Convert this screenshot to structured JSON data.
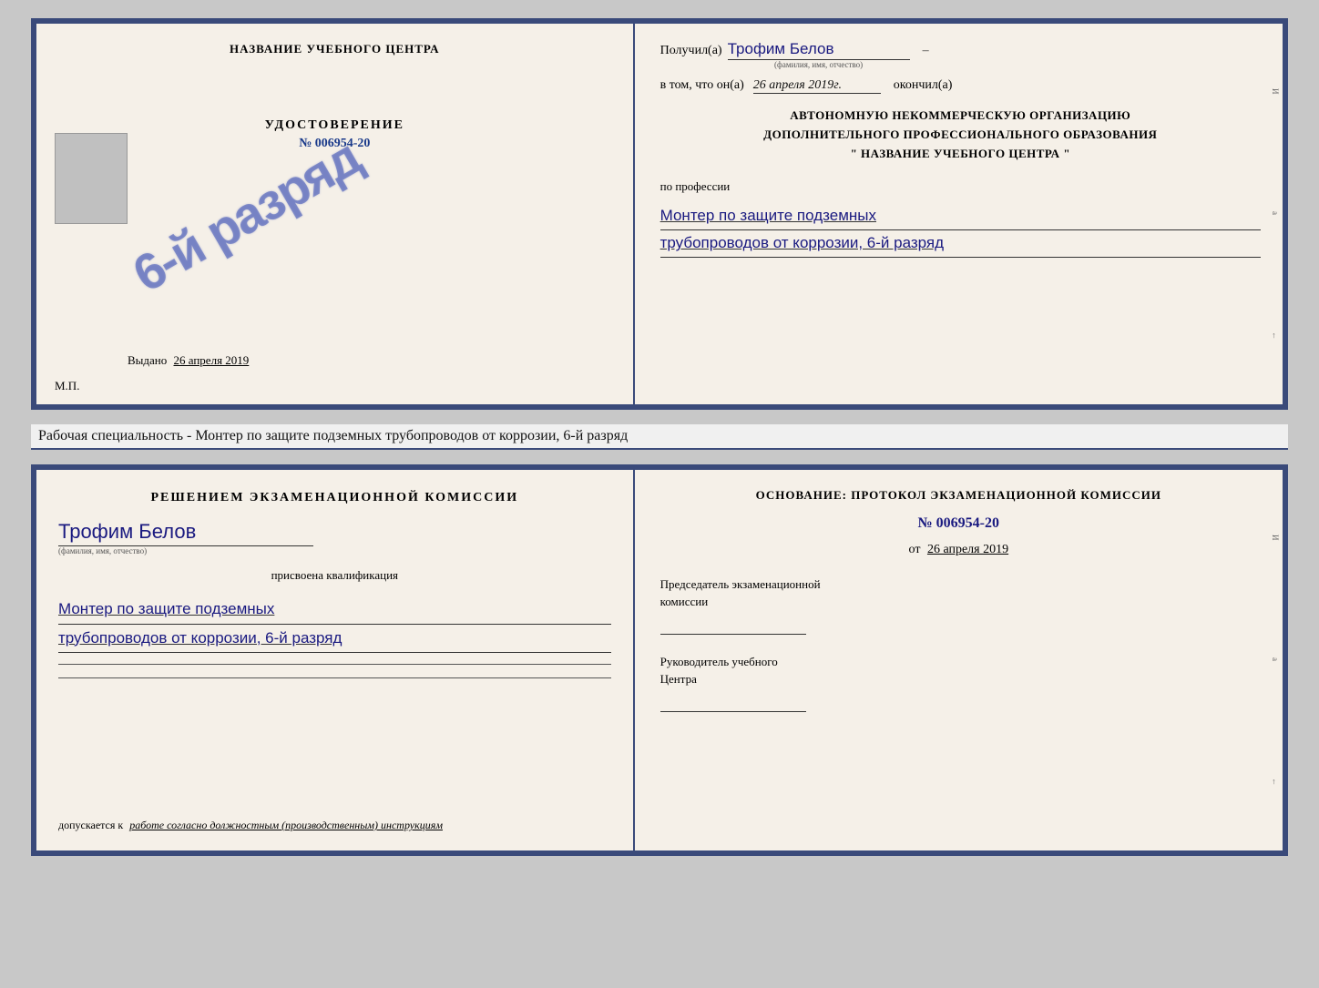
{
  "cert_top": {
    "left": {
      "center_title": "НАЗВАНИЕ УЧЕБНОГО ЦЕНТРА",
      "udost_label": "УДОСТОВЕРЕНИЕ",
      "udost_number": "№ 006954-20",
      "stamp_text": "6-й разряд",
      "vydano_label": "Выдано",
      "vydano_date": "26 апреля 2019",
      "mp_label": "М.П."
    },
    "right": {
      "poluchil_label": "Получил(а)",
      "poluchil_name": "Трофим Белов",
      "fio_hint": "(фамилия, имя, отчество)",
      "dash": "–",
      "vtom_label": "в том, что он(а)",
      "vtom_date": "26 апреля 2019г.",
      "okonchil_label": "окончил(а)",
      "org_line1": "АВТОНОМНУЮ НЕКОММЕРЧЕСКУЮ ОРГАНИЗАЦИЮ",
      "org_line2": "ДОПОЛНИТЕЛЬНОГО ПРОФЕССИОНАЛЬНОГО ОБРАЗОВАНИЯ",
      "org_line3": "\" НАЗВАНИЕ УЧЕБНОГО ЦЕНТРА \"",
      "po_professii": "по профессии",
      "profession_line1": "Монтер по защите подземных",
      "profession_line2": "трубопроводов от коррозии, 6-й разряд"
    }
  },
  "description": "Рабочая специальность - Монтер по защите подземных трубопроводов от коррозии, 6-й разряд",
  "cert_bottom": {
    "left": {
      "resheniyem_label": "Решением экзаменационной комиссии",
      "name": "Трофим Белов",
      "fio_hint": "(фамилия, имя, отчество)",
      "prisvoena": "присвоена квалификация",
      "qual_line1": "Монтер по защите подземных",
      "qual_line2": "трубопроводов от коррозии, 6-й разряд",
      "dopusk_prefix": "допускается к",
      "dopusk_text": "работе согласно должностным (производственным) инструкциям"
    },
    "right": {
      "osnovanie_label": "Основание: протокол экзаменационной комиссии",
      "protocol_number": "№ 006954-20",
      "ot_prefix": "от",
      "ot_date": "26 апреля 2019",
      "predsedatel_line1": "Председатель экзаменационной",
      "predsedatel_line2": "комиссии",
      "rukovoditel_line1": "Руководитель учебного",
      "rukovoditel_line2": "Центра"
    }
  }
}
